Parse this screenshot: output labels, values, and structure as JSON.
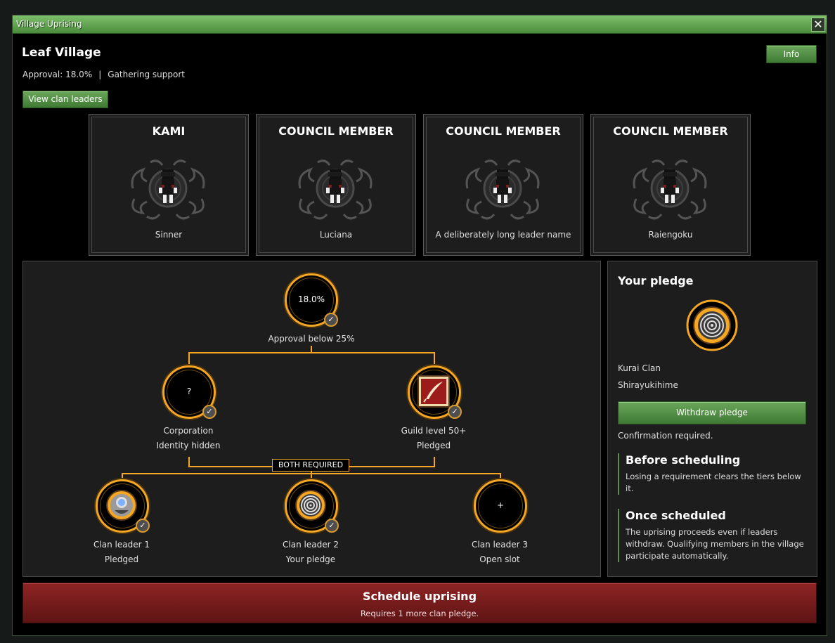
{
  "window": {
    "title": "Village Uprising",
    "close_label": "✕"
  },
  "header": {
    "village_name": "Leaf Village",
    "approval_text": "Approval: 18.0%",
    "separator": "|",
    "phase_text": "Gathering support",
    "info_label": "Info",
    "view_leaders_label": "View clan leaders"
  },
  "leaders": [
    {
      "role": "KAMI",
      "name": "Sinner"
    },
    {
      "role": "COUNCIL MEMBER",
      "name": "Luciana"
    },
    {
      "role": "COUNCIL MEMBER",
      "name": "A deliberately long leader name"
    },
    {
      "role": "COUNCIL MEMBER",
      "name": "Raiengoku"
    }
  ],
  "tree": {
    "approval": {
      "value": "18.0%",
      "label": "Approval below 25%",
      "met": true
    },
    "corporation": {
      "value": "?",
      "line1": "Corporation",
      "line2": "Identity hidden",
      "met": true
    },
    "guild": {
      "line1": "Guild level 50+",
      "line2": "Pledged",
      "met": true
    },
    "both_required": "BOTH REQUIRED",
    "clans": [
      {
        "line1": "Clan leader 1",
        "line2": "Pledged",
        "met": true
      },
      {
        "line1": "Clan leader 2",
        "line2": "Your pledge",
        "met": true
      },
      {
        "value": "+",
        "line1": "Clan leader 3",
        "line2": "Open slot",
        "met": false
      }
    ],
    "check_glyph": "✓"
  },
  "pledge": {
    "title": "Your pledge",
    "clan": "Kurai Clan",
    "member": "Shirayukihime",
    "withdraw_label": "Withdraw pledge",
    "confirm_text": "Confirmation required.",
    "before_title": "Before scheduling",
    "before_text": "Losing a requirement clears the tiers below it.",
    "after_title": "Once scheduled",
    "after_text": "The uprising proceeds even if leaders withdraw. Qualifying members in the village participate automatically."
  },
  "schedule": {
    "title": "Schedule uprising",
    "subtitle": "Requires 1 more clan pledge."
  },
  "colors": {
    "accent": "#f5a623",
    "green": "#4f8c42",
    "red": "#7a1b1b"
  },
  "icons": {
    "portrait": "shadow-ninja-portrait-icon",
    "guild": "feather-quill-icon",
    "clan1": "eye-crest-icon",
    "clan2": "spiral-crest-icon"
  }
}
